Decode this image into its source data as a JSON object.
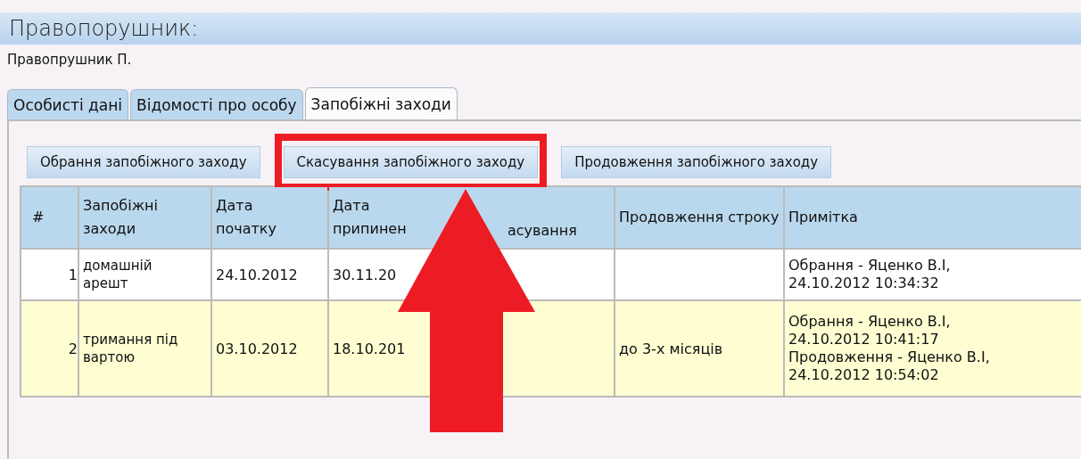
{
  "header": {
    "title": "Правопорушник:",
    "name": "Правопрушник П."
  },
  "tabs": [
    {
      "label": "Особисті дані",
      "selected": false
    },
    {
      "label": "Відомості про особу",
      "selected": false
    },
    {
      "label": "Запобіжні заходи",
      "selected": true
    }
  ],
  "actions": [
    {
      "label": "Обрання запобіжного заходу",
      "highlighted": false
    },
    {
      "label": "Скасування запобіжного заходу",
      "highlighted": true
    },
    {
      "label": "Продовження запобіжного заходу",
      "highlighted": false
    }
  ],
  "table": {
    "columns": [
      {
        "label": "#"
      },
      {
        "label": "Запобіжні заходи"
      },
      {
        "label": "Дата початку"
      },
      {
        "label": "Дата припинен",
        "label_tail": "асування"
      },
      {
        "label": "Продовження строку"
      },
      {
        "label": "Примітка"
      }
    ],
    "rows": [
      {
        "number": "1",
        "measure": "домашній арешт",
        "start": "24.10.2012",
        "end": "30.11.20",
        "extension": "",
        "notes": [
          "Обрання - Яценко В.І,",
          "24.10.2012 10:34:32"
        ],
        "highlighted": false
      },
      {
        "number": "2",
        "measure": "тримання під вартою",
        "start": "03.10.2012",
        "end": "18.10.201",
        "extension": "до 3-х місяців",
        "notes": [
          "Обрання - Яценко В.І,",
          "24.10.2012 10:41:17",
          "Продовження - Яценко В.І,",
          "24.10.2012 10:54:02"
        ],
        "highlighted": true
      }
    ]
  },
  "annotation": {
    "arrow": true
  }
}
